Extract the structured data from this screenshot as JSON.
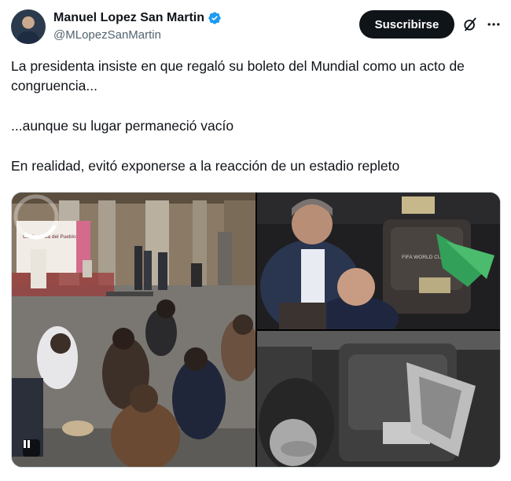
{
  "author": {
    "display_name": "Manuel Lopez San Martin",
    "handle": "@MLopezSanMartin",
    "verified": true,
    "verified_color": "#1d9bf0"
  },
  "actions": {
    "subscribe_label": "Suscribirse",
    "grok_icon": "grok-icon",
    "more_icon": "more-dots-icon"
  },
  "tweet": {
    "line1": "La presidenta insiste en que regaló su boleto del Mundial como un acto de congruencia...",
    "line2": "...aunque su lugar permaneció vacío",
    "line3": "En realidad, evitó exponerse a la reacción de un estadio repleto"
  },
  "media": {
    "video_sign_title": "Conferencia del Pueblo",
    "video_state": "loading",
    "video_control": "pause-icon",
    "seat_label": "FIFA WORLD CUP 2026"
  }
}
